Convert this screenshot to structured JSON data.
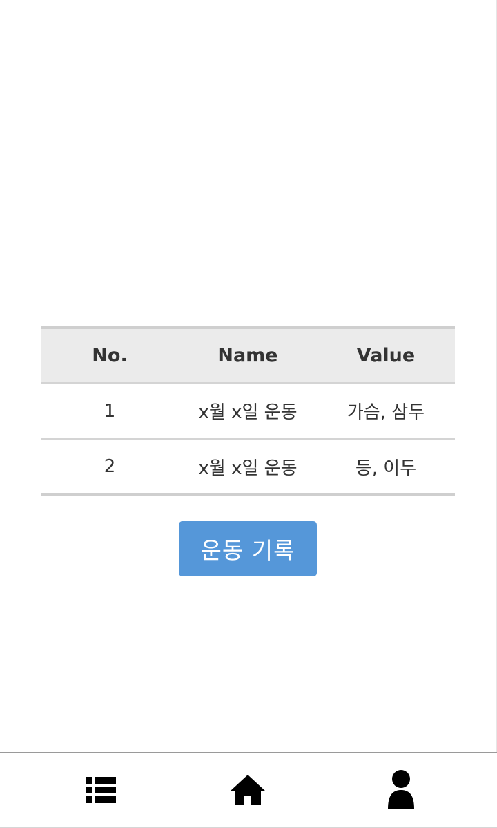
{
  "table": {
    "headers": {
      "no": "No.",
      "name": "Name",
      "value": "Value"
    },
    "rows": [
      {
        "no": "1",
        "name": "x월 x일 운동",
        "value": "가슴, 삼두"
      },
      {
        "no": "2",
        "name": "x월 x일 운동",
        "value": "등, 이두"
      }
    ]
  },
  "actions": {
    "record_label": "운동 기록"
  },
  "bottom_nav": {
    "items": [
      {
        "icon": "list-icon"
      },
      {
        "icon": "home-icon"
      },
      {
        "icon": "user-icon"
      }
    ]
  },
  "colors": {
    "accent": "#5597d9",
    "table_header_bg": "#ebebeb",
    "text": "#333333"
  }
}
